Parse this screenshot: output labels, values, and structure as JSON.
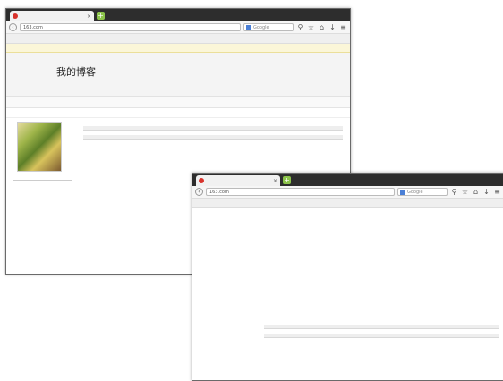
{
  "tab": {
    "title": "",
    "close": "×"
  },
  "url": {
    "domain": "163.com"
  },
  "search": {
    "placeholder": "Google"
  },
  "toolbar": {
    "back": "‹",
    "forward": "›",
    "search_icon": "⚲",
    "star": "☆",
    "home": "⌂",
    "download": "↓",
    "menu": "≡"
  },
  "blog": {
    "title": "我的博客",
    "subtitle": ""
  },
  "profile": {
    "name": "",
    "sub": ""
  },
  "page2": {
    "section_label": ""
  },
  "icons": {
    "tab_favicon": "red-favicon-icon",
    "new_tab": "plus-icon",
    "search_engine": "google-badge-icon",
    "avatar": "avatar-image"
  },
  "colors": {
    "link": "#2d5fa8",
    "notice_bg": "#fbf6d8",
    "tab_bar": "#2d2d2d",
    "new_tab": "#8bc34a"
  }
}
